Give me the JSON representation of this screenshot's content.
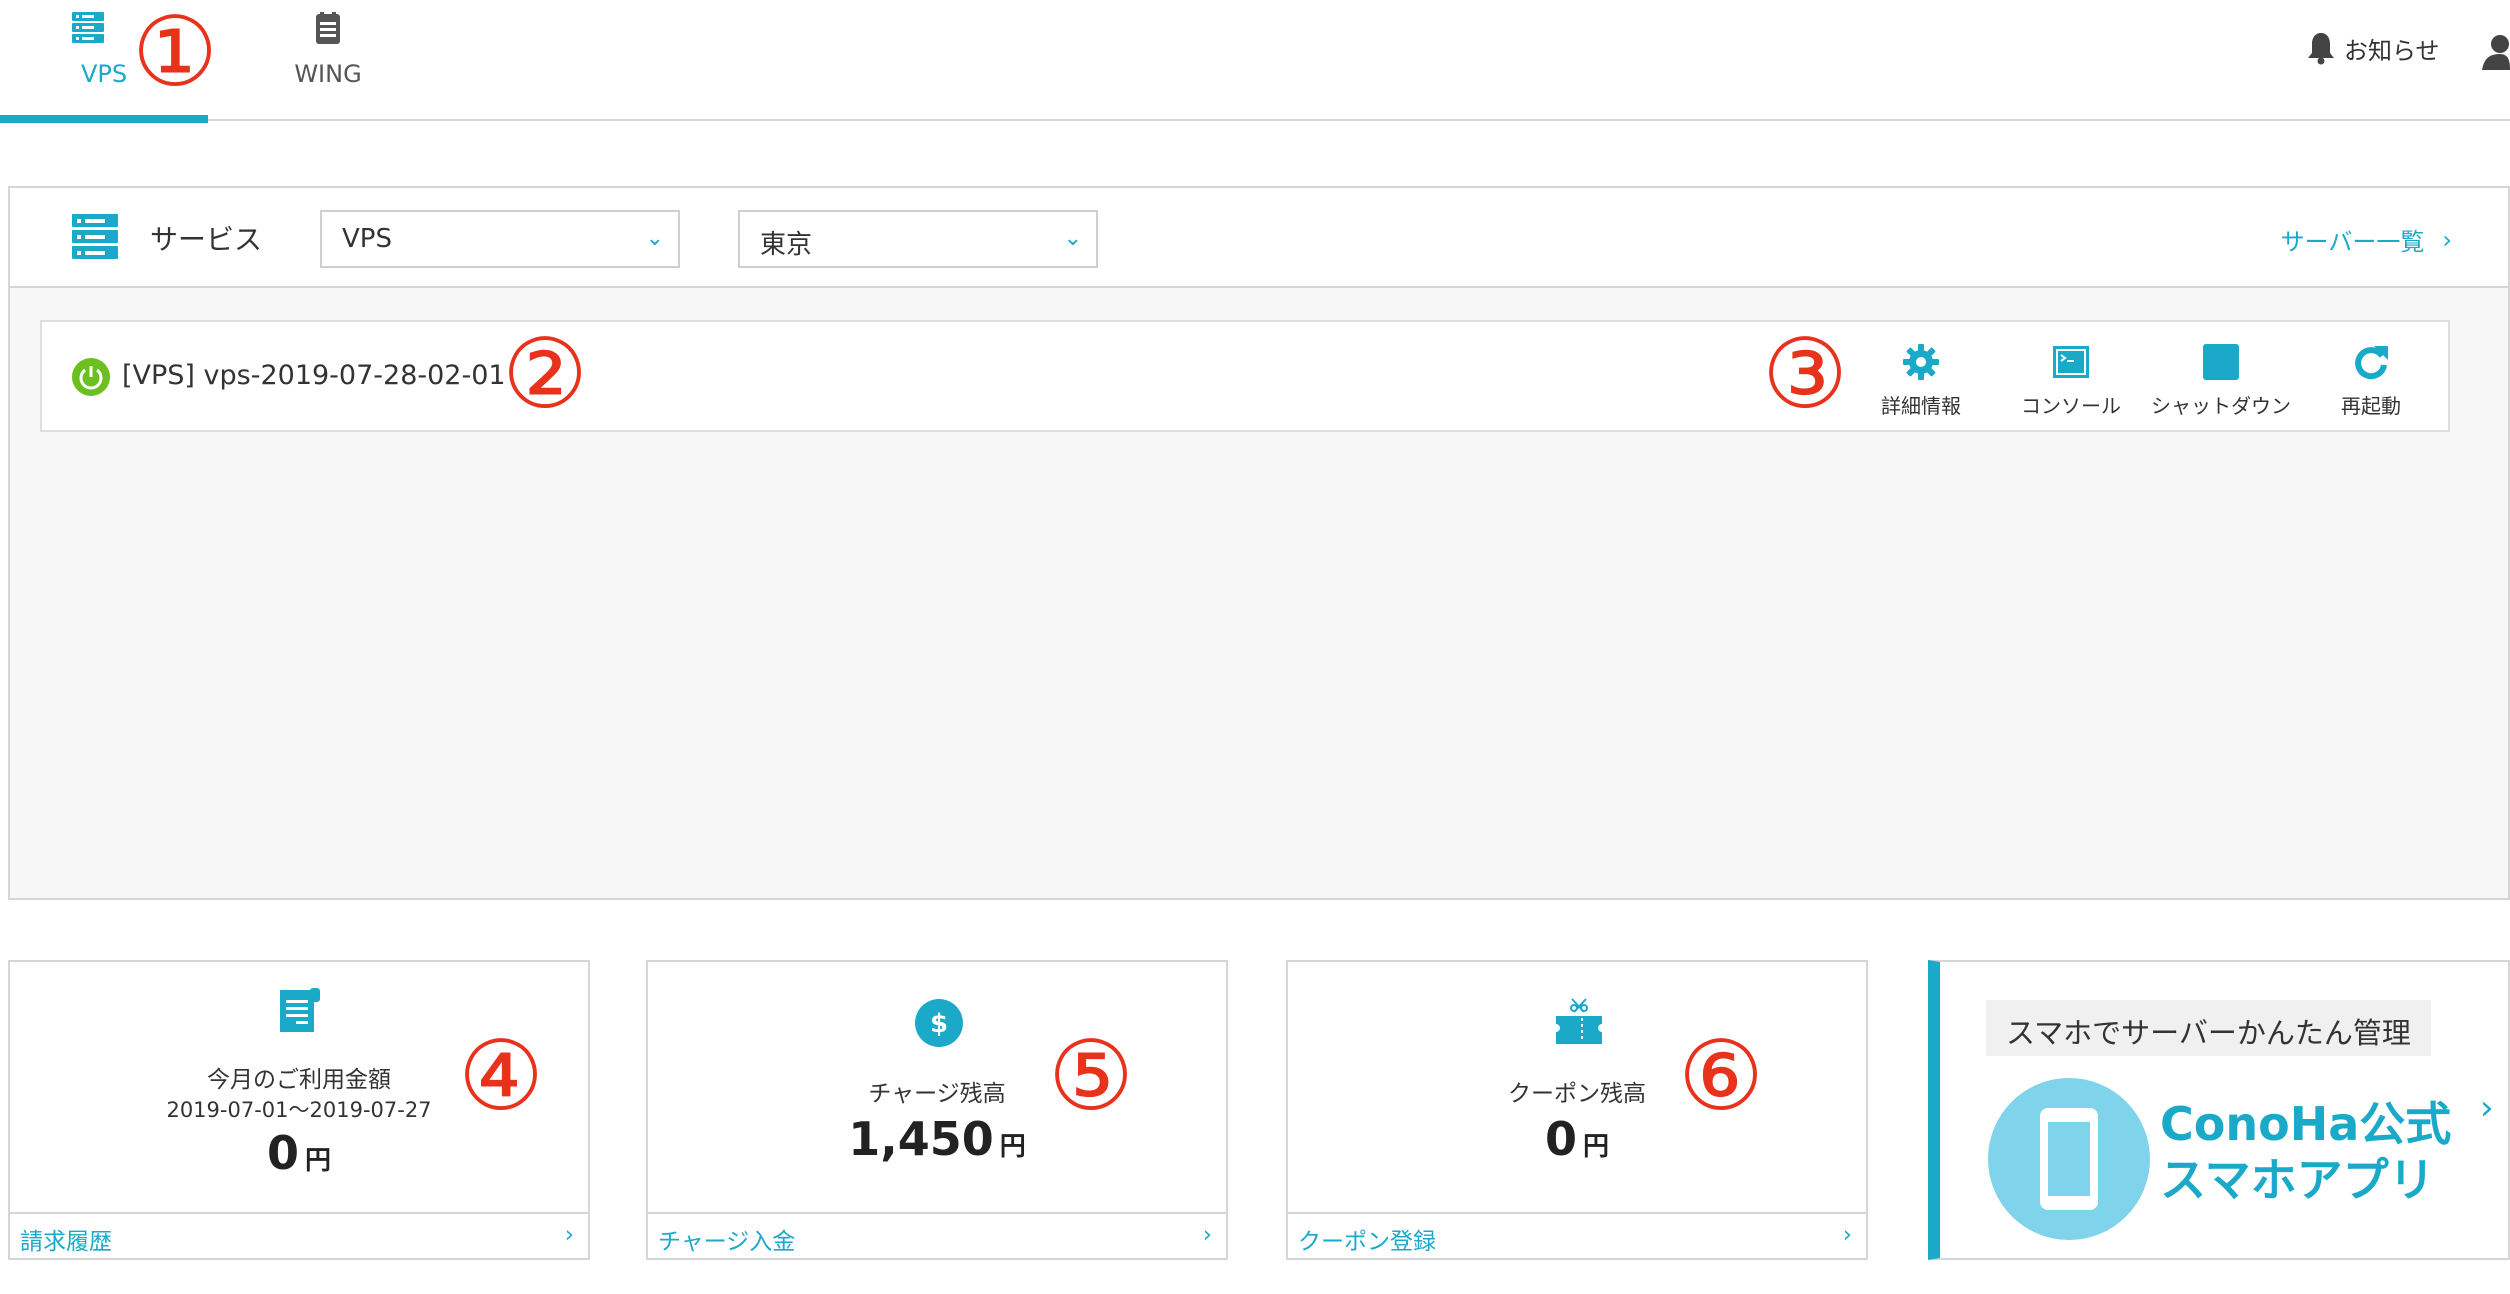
{
  "nav": {
    "tabs": [
      {
        "label": "VPS",
        "icon": "server-icon",
        "active": true
      },
      {
        "label": "WING",
        "icon": "wing-icon",
        "active": false
      }
    ],
    "notice_label": "お知らせ"
  },
  "markers": [
    "①",
    "②",
    "③",
    "④",
    "⑤",
    "⑥"
  ],
  "service_bar": {
    "label": "サービス",
    "service_select": "VPS",
    "region_select": "東京",
    "server_list_link": "サーバー一覧"
  },
  "server": {
    "name": "[VPS] vps-2019-07-28-02-01",
    "status": "running",
    "actions": [
      {
        "label": "詳細情報",
        "icon": "gear-icon"
      },
      {
        "label": "コンソール",
        "icon": "console-icon"
      },
      {
        "label": "シャットダウン",
        "icon": "stop-icon"
      },
      {
        "label": "再起動",
        "icon": "restart-icon"
      }
    ]
  },
  "cards": {
    "usage": {
      "title": "今月のご利用金額",
      "period": "2019-07-01〜2019-07-27",
      "amount": "0",
      "unit": "円",
      "link": "請求履歴"
    },
    "charge": {
      "title": "チャージ残高",
      "amount": "1,450",
      "unit": "円",
      "link": "チャージ入金"
    },
    "coupon": {
      "title": "クーポン残高",
      "amount": "0",
      "unit": "円",
      "link": "クーポン登録"
    },
    "app": {
      "badge": "スマホでサーバーかんたん管理",
      "line1": "ConoHa公式",
      "line2": "スマホアプリ"
    }
  },
  "colors": {
    "accent": "#1aa9c9",
    "marker": "#e8321c",
    "power": "#6bbf1f"
  }
}
